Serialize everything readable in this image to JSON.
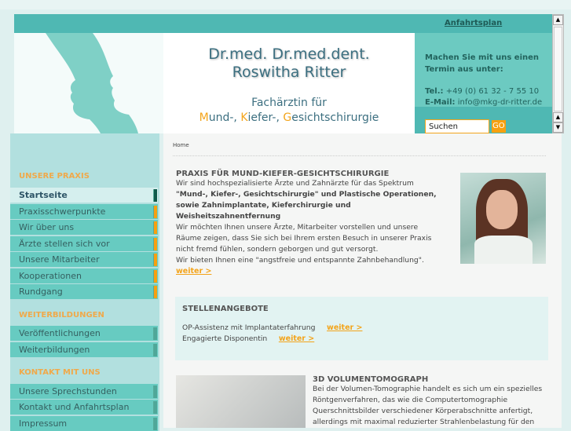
{
  "header": {
    "anfahrt_link": "Anfahrtsplan",
    "name_line1": "Dr.med. Dr.med.dent.",
    "name_line2": "Roswitha Ritter",
    "specialty_line1": "Fachärztin für",
    "specialty_M": "M",
    "specialty_und": "und-, ",
    "specialty_K": "K",
    "specialty_iefer": "iefer-, ",
    "specialty_G": "G",
    "specialty_rest": "esichtschirurgie",
    "contact_msg_line1": "Machen Sie mit uns einen",
    "contact_msg_line2": "Termin aus unter:",
    "tel_label": "Tel.:",
    "tel": " +49 (0) 61 32 - 7 55 10",
    "email_label": "E-Mail:",
    "email": " info@mkg-dr-ritter.de",
    "search_value": "Suchen",
    "go_label": "GO"
  },
  "sidebar": {
    "sections": [
      {
        "title": "UNSERE PRAXIS",
        "items": [
          "Startseite",
          "Praxisschwerpunkte",
          "Wir über uns",
          "Ärzte stellen sich vor",
          "Unsere Mitarbeiter",
          "Kooperationen",
          "Rundgang"
        ]
      },
      {
        "title": "WEITERBILDUNGEN",
        "items": [
          "Veröffentlichungen",
          "Weiterbildungen"
        ]
      },
      {
        "title": "KONTAKT MIT UNS",
        "items": [
          "Unsere Sprechstunden",
          "Kontakt und Anfahrtsplan",
          "Impressum"
        ]
      }
    ]
  },
  "main": {
    "breadcrumb": "Home",
    "intro": {
      "heading": "PRAXIS FÜR MUND-KIEFER-GESICHTSCHIRURGIE",
      "text1": "Wir sind hochspezialisierte Ärzte und Zahnärzte für das Spektrum ",
      "bold": "\"Mund-, Kiefer-, Gesichtschirurgie\" und Plastische Operationen, sowie Zahnimplantate, Kieferchirurgie und Weisheitszahnentfernung",
      "text2": "Wir möchten Ihnen unsere Ärzte, Mitarbeiter vorstellen und unsere Räume zeigen, dass Sie sich bei Ihrem ersten Besuch in unserer Praxis nicht fremd fühlen, sondern geborgen und gut versorgt.",
      "text3": "Wir bieten Ihnen eine \"angstfreie und entspannte Zahnbehandlung\".",
      "more": "weiter >"
    },
    "jobs": {
      "heading": "STELLENANGEBOTE",
      "items": [
        {
          "title": "OP-Assistenz mit Implantaterfahrung",
          "more": "weiter >"
        },
        {
          "title": "Engagierte Disponentin",
          "more": "weiter >"
        }
      ]
    },
    "vol": {
      "heading": "3D VOLUMENTOMOGRAPH",
      "text": "Bei der Volumen-Tomographie handelt es sich um ein spezielles Röntgenverfahren, das wie die Computertomographie Querschnittsbilder verschiedener Körperabschnitte anfertigt, allerdings mit maximal reduzierter Strahlenbelastung für den"
    }
  }
}
